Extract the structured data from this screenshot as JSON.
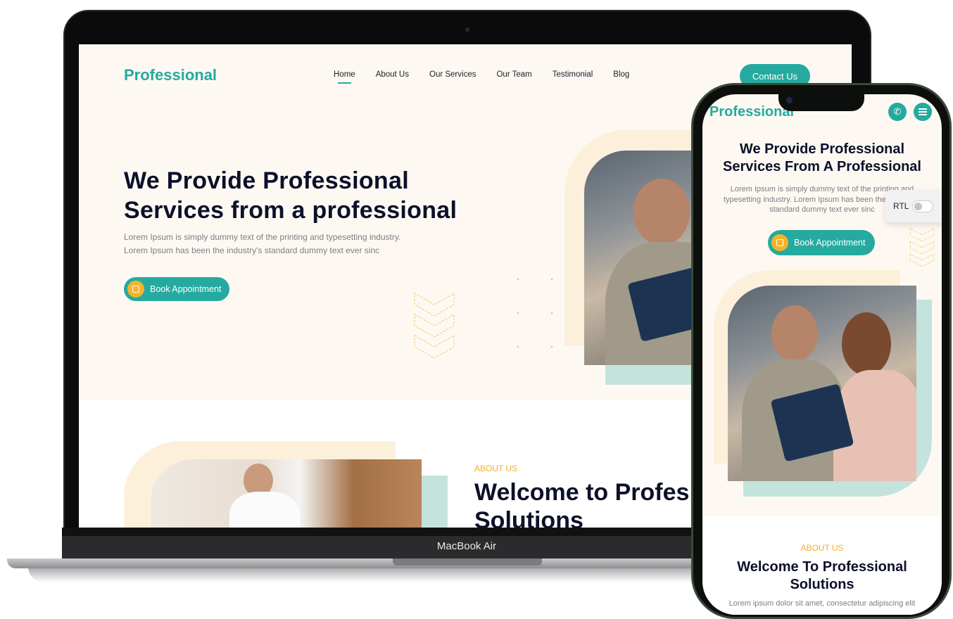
{
  "laptop": {
    "device_label": "MacBook Air",
    "site": {
      "logo": "Professional",
      "nav": [
        {
          "label": "Home",
          "active": true
        },
        {
          "label": "About Us",
          "active": false
        },
        {
          "label": "Our Services",
          "active": false
        },
        {
          "label": "Our Team",
          "active": false
        },
        {
          "label": "Testimonial",
          "active": false
        },
        {
          "label": "Blog",
          "active": false
        }
      ],
      "contact_button": "Contact Us",
      "hero": {
        "title_line1": "We Provide Professional",
        "title_line2": "Services from a professional",
        "text_line1": "Lorem Ipsum is simply dummy text of the printing and typesetting industry.",
        "text_line2": "Lorem Ipsum has been the industry's standard dummy text ever sinc",
        "cta": "Book Appointment",
        "cta_icon": "calendar-icon"
      },
      "about": {
        "label": "ABOUT US",
        "title_line1": "Welcome to Profes",
        "title_line2": "Solutions"
      }
    }
  },
  "phone": {
    "site": {
      "logo": "Professional",
      "phone_icon": "phone-icon",
      "menu_icon": "hamburger-menu-icon",
      "hero": {
        "title_line1": "We Provide Professional",
        "title_line2": "Services From A Professional",
        "text": "Lorem Ipsum is simply dummy text of the printing and typesetting industry. Lorem Ipsum has been the industry's standard dummy text ever sinc",
        "cta": "Book Appointment"
      },
      "rtl_toggle": {
        "label": "RTL",
        "enabled": false
      },
      "about": {
        "label": "ABOUT US",
        "title_line1": "Welcome To Professional",
        "title_line2": "Solutions",
        "text": "Lorem ipsum dolor sit amet, consectetur adipiscing elit"
      }
    }
  },
  "colors": {
    "primary": "#25aa9f",
    "accent": "#f2ae28",
    "heading": "#0c1029",
    "background": "#fdf9f2",
    "peach": "#fdf0da",
    "mint": "#c4e3dd"
  }
}
